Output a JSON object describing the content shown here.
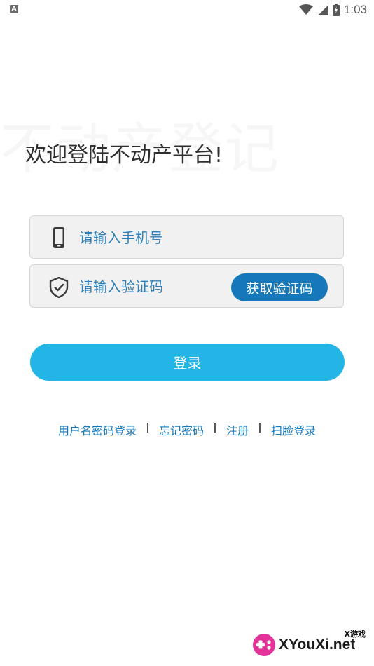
{
  "status_bar": {
    "left_icon_letter": "A",
    "time": "1:03",
    "icons": [
      "wifi-icon",
      "signal-icon",
      "battery-icon"
    ]
  },
  "watermark": "不动产登记",
  "welcome_title": "欢迎登陆不动产平台!",
  "phone_field": {
    "placeholder": "请输入手机号",
    "value": "",
    "icon": "phone-icon"
  },
  "code_field": {
    "placeholder": "请输入验证码",
    "value": "",
    "icon": "shield-check-icon",
    "get_code_label": "获取验证码"
  },
  "login_label": "登录",
  "links": {
    "username_login": "用户名密码登录",
    "forgot_password": "忘记密码",
    "register": "注册",
    "face_login": "扫脸登录"
  },
  "corner_logo": {
    "small_text": "X游戏",
    "main_text": "XYouXi.net"
  },
  "colors": {
    "accent": "#1678b9",
    "login_button": "#22b5e6",
    "field_bg": "#f1f1f1"
  }
}
